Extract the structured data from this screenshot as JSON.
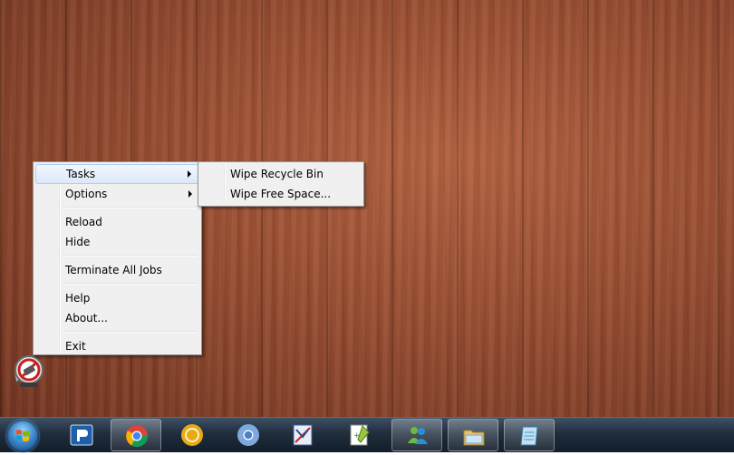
{
  "context_menu": {
    "items": [
      {
        "label": "Tasks"
      },
      {
        "label": "Options"
      },
      {
        "label": "Reload"
      },
      {
        "label": "Hide"
      },
      {
        "label": "Terminate All Jobs"
      },
      {
        "label": "Help"
      },
      {
        "label": "About..."
      },
      {
        "label": "Exit"
      }
    ],
    "highlighted": "Tasks"
  },
  "submenu": {
    "items": [
      {
        "label": "Wipe Recycle Bin"
      },
      {
        "label": "Wipe Free Space..."
      }
    ]
  },
  "desktop": {
    "tray_app_icon": "eraser-app-icon"
  },
  "taskbar": {
    "buttons": [
      {
        "icon": "start-orb-icon"
      },
      {
        "icon": "app-p-icon"
      },
      {
        "icon": "chrome-icon",
        "active": true
      },
      {
        "icon": "yellow-circle-icon"
      },
      {
        "icon": "chromium-icon"
      },
      {
        "icon": "visual-studio-icon"
      },
      {
        "icon": "notepad-plus-icon"
      },
      {
        "icon": "messenger-icon",
        "active": true
      },
      {
        "icon": "file-explorer-icon",
        "active": true
      },
      {
        "icon": "notepad-icon",
        "active": true
      }
    ]
  }
}
